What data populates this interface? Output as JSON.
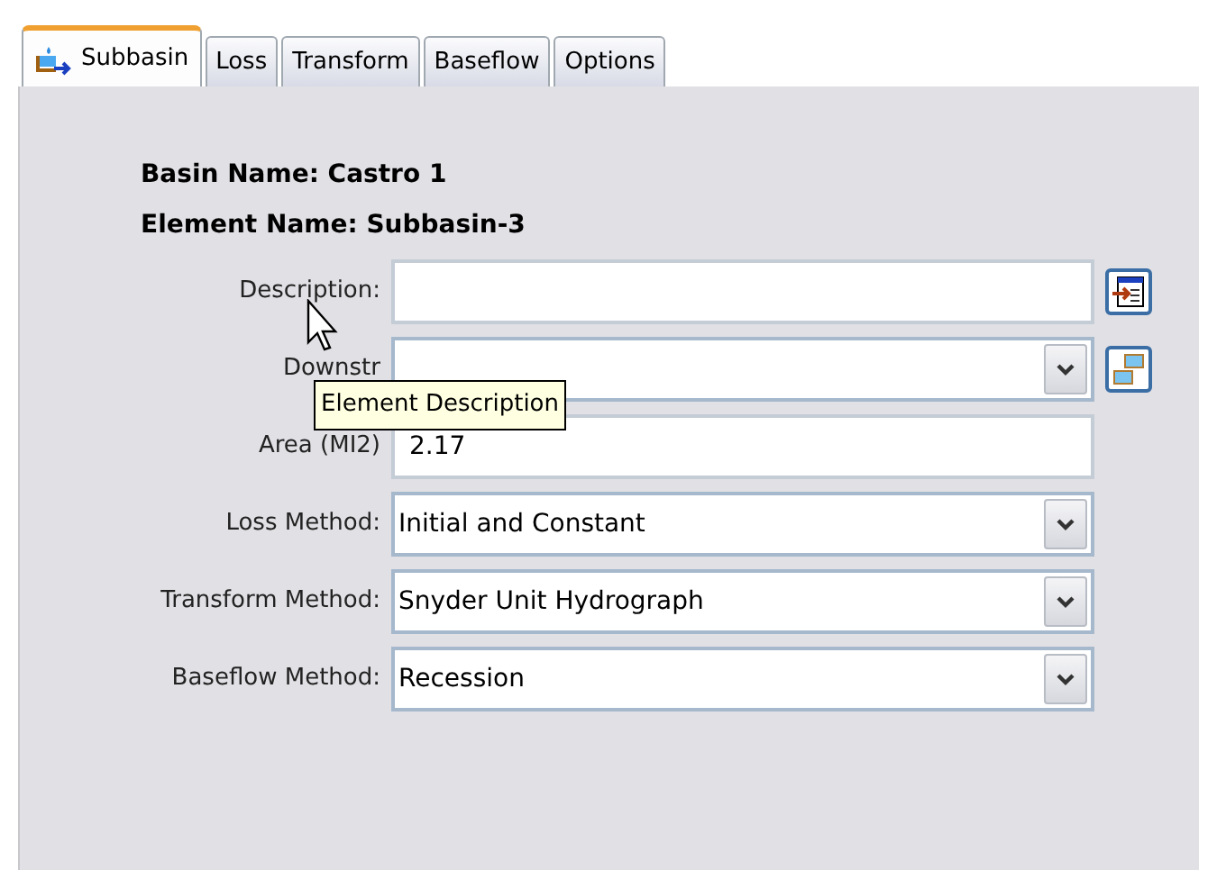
{
  "tabs": [
    {
      "label": "Subbasin",
      "selected": true,
      "icon": true
    },
    {
      "label": "Loss",
      "selected": false
    },
    {
      "label": "Transform",
      "selected": false
    },
    {
      "label": "Baseflow",
      "selected": false
    },
    {
      "label": "Options",
      "selected": false
    }
  ],
  "header": [
    {
      "label": "Basin Name: Castro 1"
    },
    {
      "label": "Element Name: Subbasin-3"
    }
  ],
  "fields": [
    {
      "label": "Description:",
      "kind": "text"
    },
    {
      "label": "Downstr",
      "kind": "dropdown"
    },
    {
      "label": "Area (MI2)",
      "kind": "text",
      "value": "2.17"
    },
    {
      "label": "Loss Method:",
      "kind": "dropdown",
      "value": "Initial and Constant"
    },
    {
      "label": "Transform Method:",
      "kind": "dropdown",
      "value": "Snyder Unit Hydrograph"
    },
    {
      "label": "Baseflow Method:",
      "kind": "dropdown",
      "value": "Recession"
    }
  ],
  "tooltip": "Element Description"
}
